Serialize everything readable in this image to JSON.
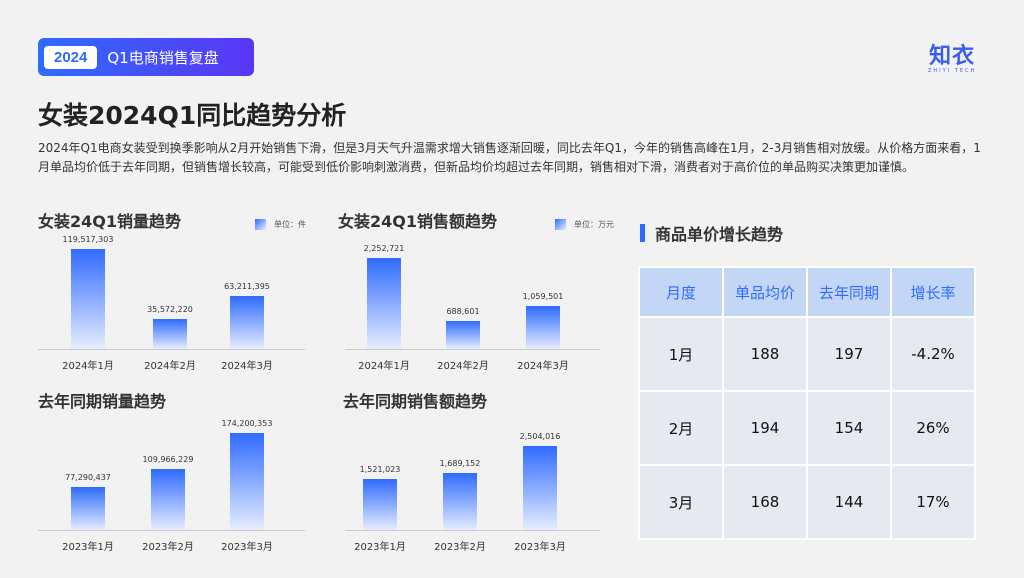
{
  "header": {
    "year": "2024",
    "subtitle": "Q1电商销售复盘",
    "logo_main": "知衣",
    "logo_sub": "ZHIYI TECH"
  },
  "title": "女装2024Q1同比趋势分析",
  "description": "2024年Q1电商女装受到换季影响从2月开始销售下滑，但是3月天气升温需求增大销售逐渐回暖，同比去年Q1，今年的销售高峰在1月，2-3月销售相对放缓。从价格方面来看，1月单品均价低于去年同期，但销售增长较高，可能受到低价影响刺激消费，但新品均价均超过去年同期，销售相对下滑，消费者对于高价位的单品购买决策更加谨慎。",
  "chart_data": [
    {
      "type": "bar",
      "title": "女装24Q1销量趋势",
      "unit": "单位：件",
      "categories": [
        "2024年1月",
        "2024年2月",
        "2024年3月"
      ],
      "values": [
        119517303,
        35572220,
        63211395
      ],
      "labels": [
        "119,517,303",
        "35,572,220",
        "63,211,395"
      ]
    },
    {
      "type": "bar",
      "title": "女装24Q1销售额趋势",
      "unit": "单位：万元",
      "categories": [
        "2024年1月",
        "2024年2月",
        "2024年3月"
      ],
      "values": [
        2252721,
        688601,
        1059501
      ],
      "labels": [
        "2,252,721",
        "688,601",
        "1,059,501"
      ]
    },
    {
      "type": "bar",
      "title": "去年同期销量趋势",
      "categories": [
        "2023年1月",
        "2023年2月",
        "2023年3月"
      ],
      "values": [
        77290437,
        109966229,
        174200353
      ],
      "labels": [
        "77,290,437",
        "109,966,229",
        "174,200,353"
      ]
    },
    {
      "type": "bar",
      "title": "去年同期销售额趋势",
      "categories": [
        "2023年1月",
        "2023年2月",
        "2023年3月"
      ],
      "values": [
        1521023,
        1689152,
        2504016
      ],
      "labels": [
        "1,521,023",
        "1,689,152",
        "2,504,016"
      ]
    }
  ],
  "table": {
    "title": "商品单价增长趋势",
    "headers": [
      "月度",
      "单品均价",
      "去年同期",
      "增长率"
    ],
    "rows": [
      [
        "1月",
        "188",
        "197",
        "-4.2%"
      ],
      [
        "2月",
        "194",
        "154",
        "26%"
      ],
      [
        "3月",
        "168",
        "144",
        "17%"
      ]
    ]
  }
}
